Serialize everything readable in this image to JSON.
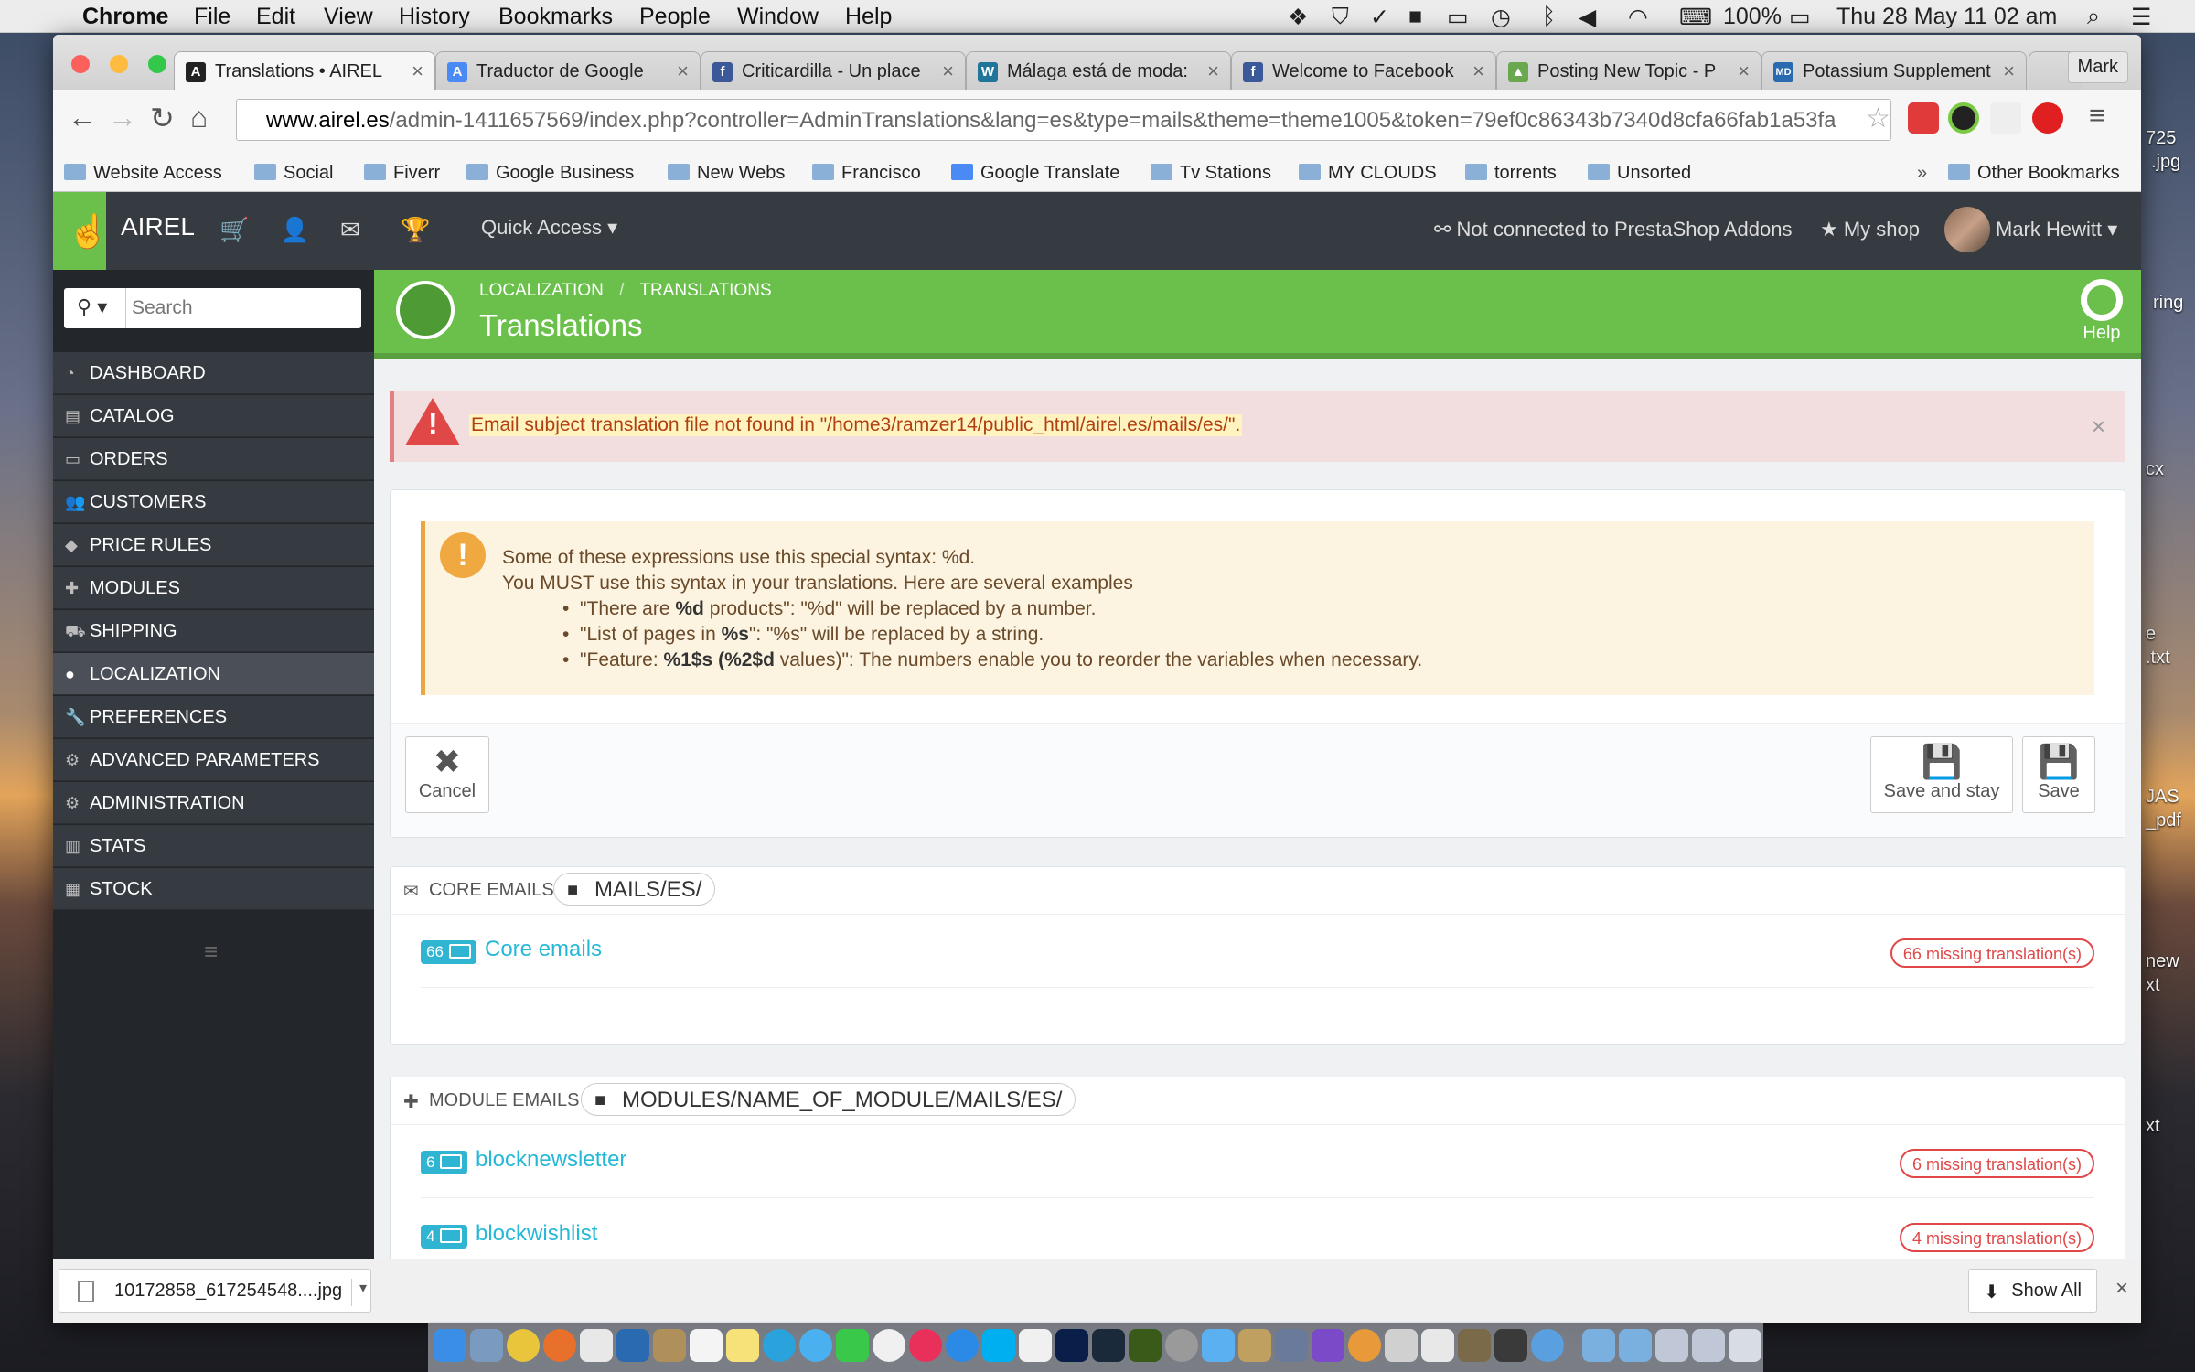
{
  "menubar": {
    "app": "Chrome",
    "items": [
      "File",
      "Edit",
      "View",
      "History",
      "Bookmarks",
      "People",
      "Window",
      "Help"
    ],
    "battery": "100%",
    "datetime": "Thu 28 May  11 02 am"
  },
  "tabs": [
    {
      "title": "Translations • AIREL",
      "icon": "prestashop-favicon",
      "color": "#222222"
    },
    {
      "title": "Traductor de Google",
      "icon": "google-translate-favicon",
      "color": "#4a8af4"
    },
    {
      "title": "Criticardilla - Un place",
      "icon": "facebook-favicon",
      "color": "#3b5998"
    },
    {
      "title": "Málaga está de moda:",
      "icon": "wordpress-favicon",
      "color": "#21759b"
    },
    {
      "title": "Welcome to Facebook",
      "icon": "facebook-favicon",
      "color": "#3b5998"
    },
    {
      "title": "Posting New Topic - P",
      "icon": "forum-favicon",
      "color": "#6aa84f"
    },
    {
      "title": "Potassium Supplement",
      "icon": "webmd-favicon",
      "color": "#2a6ab0"
    }
  ],
  "profile_name": "Mark",
  "url": {
    "domain": "www.airel.es",
    "path": "/admin-1411657569/index.php?controller=AdminTranslations&lang=es&type=mails&theme=theme1005&token=79ef0c86343b7340d8cfa66fab1a53fa"
  },
  "bookmarks": [
    "Website Access",
    "Social",
    "Fiverr",
    "Google Business",
    "New Webs",
    "Francisco",
    "Google Translate",
    "Tv Stations",
    "MY CLOUDS",
    "torrents",
    "Unsorted"
  ],
  "other_bookmarks": "Other Bookmarks",
  "header": {
    "brand": "AIREL",
    "quick_access": "Quick Access ▾",
    "addons_status": "Not connected to PrestaShop Addons",
    "my_shop": "My shop",
    "user": "Mark Hewitt ▾"
  },
  "sidebar": {
    "search_placeholder": "Search",
    "items": [
      {
        "label": "Dashboard",
        "icon": "dashboard-icon"
      },
      {
        "label": "Catalog",
        "icon": "book-icon"
      },
      {
        "label": "Orders",
        "icon": "credit-card-icon"
      },
      {
        "label": "Customers",
        "icon": "users-icon"
      },
      {
        "label": "Price Rules",
        "icon": "tags-icon"
      },
      {
        "label": "Modules",
        "icon": "puzzle-icon"
      },
      {
        "label": "Shipping",
        "icon": "truck-icon"
      },
      {
        "label": "Localization",
        "icon": "globe-icon",
        "active": true
      },
      {
        "label": "Preferences",
        "icon": "wrench-icon"
      },
      {
        "label": "Advanced Parameters",
        "icon": "cogs-icon"
      },
      {
        "label": "Administration",
        "icon": "cog-icon"
      },
      {
        "label": "Stats",
        "icon": "bar-chart-icon"
      },
      {
        "label": "Stock",
        "icon": "archive-icon"
      }
    ]
  },
  "page": {
    "breadcrumb": [
      "LOCALIZATION",
      "TRANSLATIONS"
    ],
    "title": "Translations",
    "help_label": "Help"
  },
  "error_alert": "Email subject translation file not found in \"/home3/ramzer14/public_html/airel.es/mails/es/\".",
  "warning": {
    "line1": "Some of these expressions use this special syntax: %d.",
    "line2": "You MUST use this syntax in your translations. Here are several examples",
    "ex1_pre": "\"There are ",
    "ex1_bold": "%d",
    "ex1_post": " products\": \"%d\" will be replaced by a number.",
    "ex2_pre": "\"List of pages in ",
    "ex2_bold": "%s",
    "ex2_post": "\": \"%s\" will be replaced by a string.",
    "ex3_pre": "\"Feature: ",
    "ex3_bold": "%1$s (%2$d",
    "ex3_post": " values)\": The numbers enable you to reorder the variables when necessary."
  },
  "actions": {
    "cancel": "Cancel",
    "save_and_stay": "Save and stay",
    "save": "Save"
  },
  "core_emails": {
    "heading": "Core emails",
    "folder": "MAILS/ES/",
    "rows": [
      {
        "count": "66",
        "name": "Core emails",
        "missing": "66 missing translation(s)"
      }
    ]
  },
  "module_emails": {
    "heading": "Module emails",
    "folder": "MODULES/NAME_OF_MODULE/MAILS/ES/",
    "rows": [
      {
        "count": "6",
        "name": "blocknewsletter",
        "missing": "6 missing translation(s)"
      },
      {
        "count": "4",
        "name": "blockwishlist",
        "missing": "4 missing translation(s)"
      }
    ]
  },
  "download": {
    "file": "10172858_617254548....jpg",
    "show_all": "Show All"
  },
  "desktop_labels": [
    "725",
    ".jpg",
    "ring",
    "cx",
    "e",
    ".txt",
    "new",
    "xt",
    "xt",
    "JAS",
    "_pdf"
  ]
}
